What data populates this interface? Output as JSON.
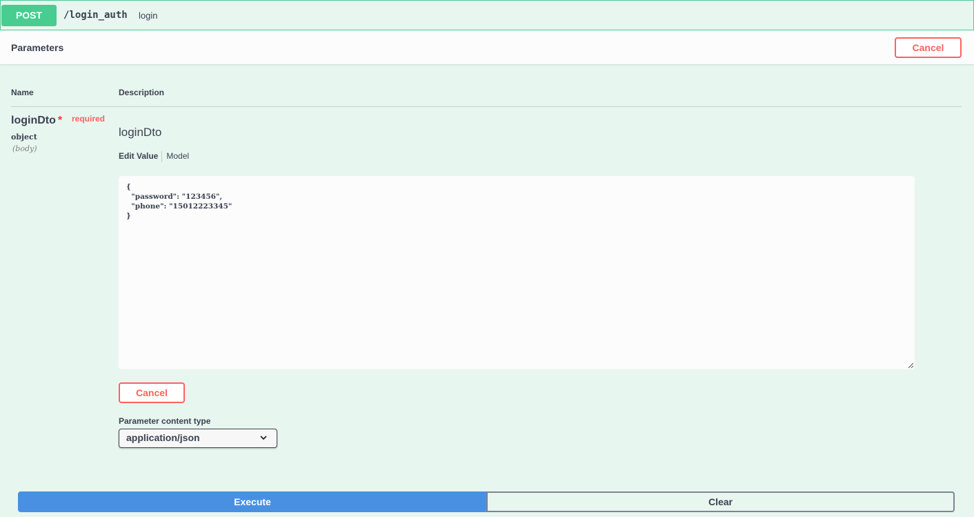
{
  "operation": {
    "method": "POST",
    "path": "/login_auth",
    "summary": "login",
    "accent_color": "#49cc90"
  },
  "parameters_section": {
    "title": "Parameters",
    "cancel_label": "Cancel"
  },
  "table": {
    "col_name": "Name",
    "col_description": "Description"
  },
  "param": {
    "name": "loginDto",
    "required_star": "*",
    "required_label": "required",
    "type": "object",
    "in": "(body)",
    "description": "loginDto",
    "tab_edit_value": "Edit Value",
    "tab_model": "Model",
    "body_value": "{\n  \"password\": \"123456\",\n  \"phone\": \"15012223345\"\n}"
  },
  "editor": {
    "cancel_label": "Cancel"
  },
  "content_type": {
    "label": "Parameter content type",
    "selected": "application/json",
    "icon": "chevron-down-icon"
  },
  "actions": {
    "execute_label": "Execute",
    "clear_label": "Clear",
    "execute_color": "#4990e2"
  }
}
